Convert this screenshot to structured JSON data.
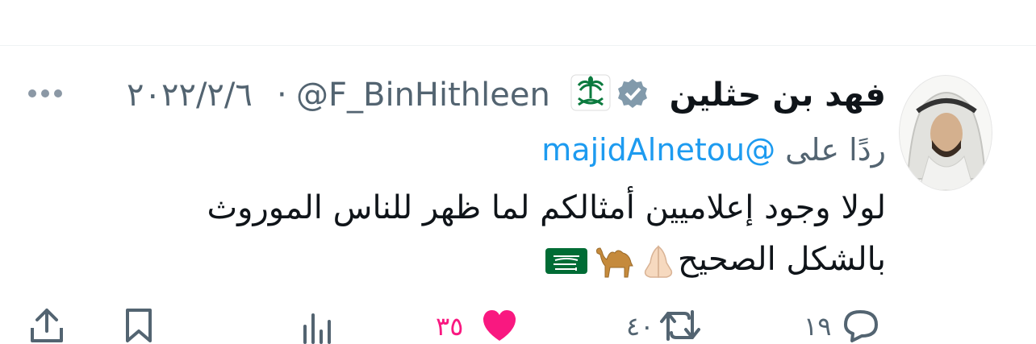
{
  "tweet": {
    "author_name": "فهد بن حثلين",
    "handle": "@F_BinHithleen",
    "separator": "·",
    "date": "٢٠٢٢/٢/٦",
    "reply_prefix": "ردًا على",
    "reply_to": "@majidAlnetou",
    "body_line1": "لولا وجود إعلاميين أمثالكم لما ظهر للناس الموروث",
    "body_line2": "بالشكل الصحيح",
    "emojis": [
      "folded-hands",
      "camel",
      "saudi-flag"
    ]
  },
  "actions": {
    "replies": "١٩",
    "retweets": "٤٠",
    "likes": "٣٥",
    "liked": true
  },
  "colors": {
    "like_pink": "#f91880",
    "link_blue": "#1d9bf0",
    "muted_gray": "#536471",
    "verified_gray": "#829aab",
    "flag_green": "#006c35"
  }
}
